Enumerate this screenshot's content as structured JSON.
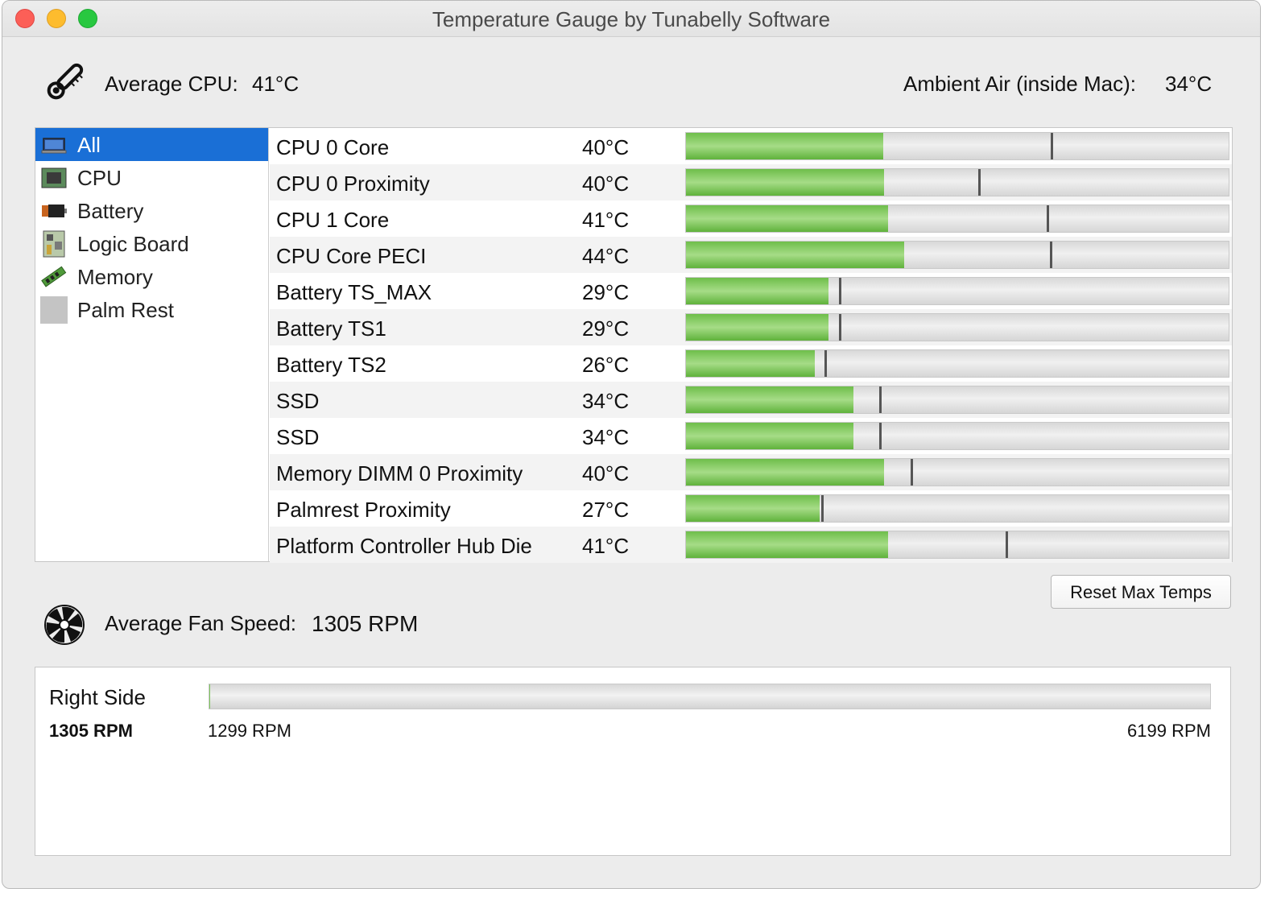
{
  "window": {
    "title": "Temperature Gauge by Tunabelly Software"
  },
  "header": {
    "avg_cpu_label": "Average CPU:",
    "avg_cpu_value": "41°C",
    "ambient_label": "Ambient Air (inside Mac):",
    "ambient_value": "34°C"
  },
  "sidebar": {
    "selected": "All",
    "items": [
      {
        "label": "All",
        "icon": "laptop-icon"
      },
      {
        "label": "CPU",
        "icon": "cpu-chip-icon"
      },
      {
        "label": "Battery",
        "icon": "battery-icon"
      },
      {
        "label": "Logic Board",
        "icon": "logic-board-icon"
      },
      {
        "label": "Memory",
        "icon": "memory-stick-icon"
      },
      {
        "label": "Palm Rest",
        "icon": "palm-rest-icon"
      }
    ]
  },
  "sensors": [
    {
      "name": "CPU 0 Core",
      "value": "40°C",
      "fill": 0.363,
      "max": 0.674
    },
    {
      "name": "CPU 0 Proximity",
      "value": "40°C",
      "fill": 0.365,
      "max": 0.54
    },
    {
      "name": "CPU 1 Core",
      "value": "41°C",
      "fill": 0.372,
      "max": 0.666
    },
    {
      "name": "CPU Core PECI",
      "value": "44°C",
      "fill": 0.402,
      "max": 0.672
    },
    {
      "name": "Battery TS_MAX",
      "value": "29°C",
      "fill": 0.262,
      "max": 0.283
    },
    {
      "name": "Battery TS1",
      "value": "29°C",
      "fill": 0.262,
      "max": 0.283
    },
    {
      "name": "Battery TS2",
      "value": "26°C",
      "fill": 0.238,
      "max": 0.256
    },
    {
      "name": "SSD",
      "value": "34°C",
      "fill": 0.308,
      "max": 0.357
    },
    {
      "name": "SSD",
      "value": "34°C",
      "fill": 0.308,
      "max": 0.357
    },
    {
      "name": "Memory DIMM 0 Proximity",
      "value": "40°C",
      "fill": 0.365,
      "max": 0.415
    },
    {
      "name": "Palmrest Proximity",
      "value": "27°C",
      "fill": 0.247,
      "max": 0.25
    },
    {
      "name": "Platform Controller Hub Die",
      "value": "41°C",
      "fill": 0.372,
      "max": 0.59
    }
  ],
  "reset_button": {
    "label": "Reset Max Temps"
  },
  "fan_summary": {
    "label": "Average Fan Speed:",
    "value": "1305 RPM"
  },
  "fans": [
    {
      "name": "Right Side",
      "current": "1305 RPM",
      "min": "1299 RPM",
      "max_rpm": "6199 RPM",
      "fill": 0.001
    }
  ],
  "colors": {
    "selection": "#1a6fd6",
    "bar_fill": "#7cc45a",
    "max_marker": "#555555"
  }
}
